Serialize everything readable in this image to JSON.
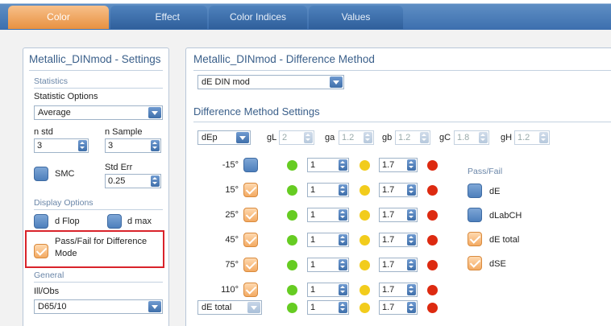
{
  "tabs": [
    {
      "label": "Color",
      "active": true
    },
    {
      "label": "Effect",
      "active": false
    },
    {
      "label": "Color Indices",
      "active": false
    },
    {
      "label": "Values",
      "active": false
    }
  ],
  "settings": {
    "title": "Metallic_DINmod - Settings",
    "statistics": {
      "section": "Statistics",
      "options_label": "Statistic Options",
      "options_value": "Average",
      "n_std_label": "n std",
      "n_std_value": "3",
      "n_sample_label": "n Sample",
      "n_sample_value": "3",
      "smc_label": "SMC",
      "smc_checked": false,
      "std_err_label": "Std Err",
      "std_err_value": "0.25"
    },
    "display": {
      "section": "Display Options",
      "d_flop_label": "d Flop",
      "d_flop_checked": false,
      "d_max_label": "d max",
      "d_max_checked": false,
      "pass_fail_label_line1": "Pass/Fail for Difference",
      "pass_fail_label_line2": "Mode",
      "pass_fail_checked": true
    },
    "general": {
      "section": "General",
      "ill_obs_label": "Ill/Obs",
      "ill_obs_value": "D65/10"
    }
  },
  "method": {
    "title": "Metallic_DINmod - Difference Method",
    "method_value": "dE DIN mod",
    "settings_title": "Difference Method Settings",
    "metric_value": "dEp",
    "weights": [
      {
        "label": "gL",
        "value": "2"
      },
      {
        "label": "ga",
        "value": "1.2"
      },
      {
        "label": "gb",
        "value": "1.2"
      },
      {
        "label": "gC",
        "value": "1.8"
      },
      {
        "label": "gH",
        "value": "1.2"
      }
    ],
    "rows": [
      {
        "angle": "-15°",
        "checked": false,
        "low": "1",
        "high": "1.7"
      },
      {
        "angle": "15°",
        "checked": true,
        "low": "1",
        "high": "1.7"
      },
      {
        "angle": "25°",
        "checked": true,
        "low": "1",
        "high": "1.7"
      },
      {
        "angle": "45°",
        "checked": true,
        "low": "1",
        "high": "1.7"
      },
      {
        "angle": "75°",
        "checked": true,
        "low": "1",
        "high": "1.7"
      },
      {
        "angle": "110°",
        "checked": true,
        "low": "1",
        "high": "1.7"
      }
    ],
    "total_row": {
      "select": "dE total",
      "low": "1",
      "high": "1.7"
    },
    "pass_fail": {
      "title": "Pass/Fail",
      "items": [
        {
          "label": "dE",
          "checked": false
        },
        {
          "label": "dLabCH",
          "checked": false
        },
        {
          "label": "dE total",
          "checked": true
        },
        {
          "label": "dSE",
          "checked": true
        }
      ]
    }
  },
  "colors": {
    "accent": "#3c6fae",
    "active_tab": "#e89141",
    "highlight_box": "#d9232b"
  }
}
